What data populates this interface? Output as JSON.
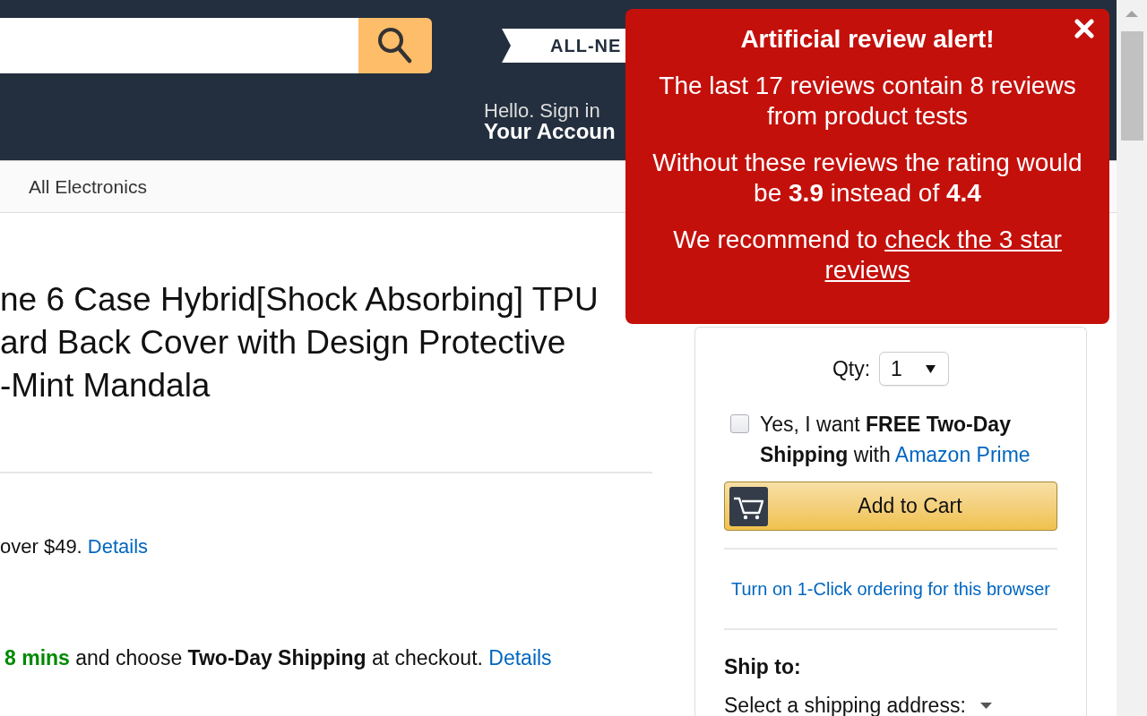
{
  "header": {
    "banner": "ALL-NE",
    "greeting": "Hello. Sign in",
    "account": "Your Accoun"
  },
  "subnav": {
    "items": [
      {
        "label": "All Electronics"
      }
    ]
  },
  "product": {
    "title_lines": [
      "ne 6 Case Hybrid[Shock Absorbing] TPU",
      "ard Back Cover with Design Protective",
      "-Mint Mandala"
    ],
    "shipping_note": {
      "text": "over $49.",
      "link": "Details"
    },
    "delivery_note": {
      "countdown": "8 mins",
      "text": "and choose **Two-Day Shipping** at checkout.",
      "link": "Details"
    }
  },
  "buybox": {
    "qty_label": "Qty:",
    "qty_value": "1",
    "prime_option": {
      "checked": false,
      "text": "Yes, I want **FREE Two-Day Shipping** with",
      "link": "Amazon Prime"
    },
    "add_to_cart": "Add to Cart",
    "one_click_link": "Turn on 1-Click ordering for this browser",
    "ship_to_label": "Ship to:",
    "address_select": "Select a shipping address:"
  },
  "alert": {
    "title": "Artificial review alert!",
    "messages": [
      {
        "text": "The last 17 reviews contain 8 reviews from product tests"
      },
      {
        "text": "Without these reviews the rating would be **3.9** instead of **4.4**"
      },
      {
        "text": "We recommend to",
        "link_parts": [
          "check the 3 star",
          "reviews"
        ]
      }
    ]
  }
}
